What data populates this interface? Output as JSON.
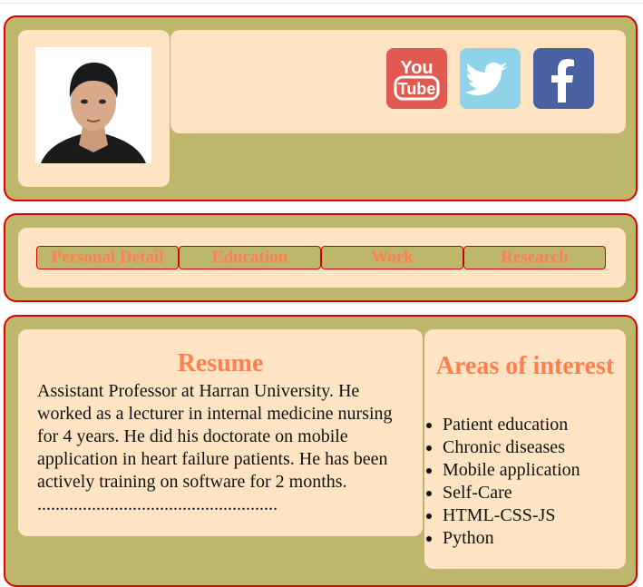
{
  "header": {
    "photo_alt": "Profile photo",
    "social": [
      {
        "name": "YouTube",
        "icon": "youtube-icon",
        "text_top": "You",
        "text_bottom": "Tube",
        "color": "#e05a52"
      },
      {
        "name": "Twitter",
        "icon": "twitter-icon",
        "color": "#8fd3ea"
      },
      {
        "name": "Facebook",
        "icon": "facebook-icon",
        "color": "#4a61a1"
      }
    ]
  },
  "nav": {
    "items": [
      "Personal Detail",
      "Education",
      "Work",
      "Research"
    ]
  },
  "resume": {
    "title": "Resume",
    "text": "Assistant Professor at Harran University. He worked as a lecturer in internal medicine nursing for 4 years. He did his doctorate on mobile application in heart failure patients. He has been actively training on software for 2 months. ....................................................."
  },
  "interests": {
    "title": "Areas of interest",
    "items": [
      "Patient education",
      "Chronic diseases",
      "Mobile application",
      "Self-Care",
      "HTML-CSS-JS",
      "Python"
    ]
  },
  "colors": {
    "section_bg": "#bdb76b",
    "card_bg": "#ffe4c4",
    "border": "#e00000",
    "accent": "#ff7f50"
  }
}
